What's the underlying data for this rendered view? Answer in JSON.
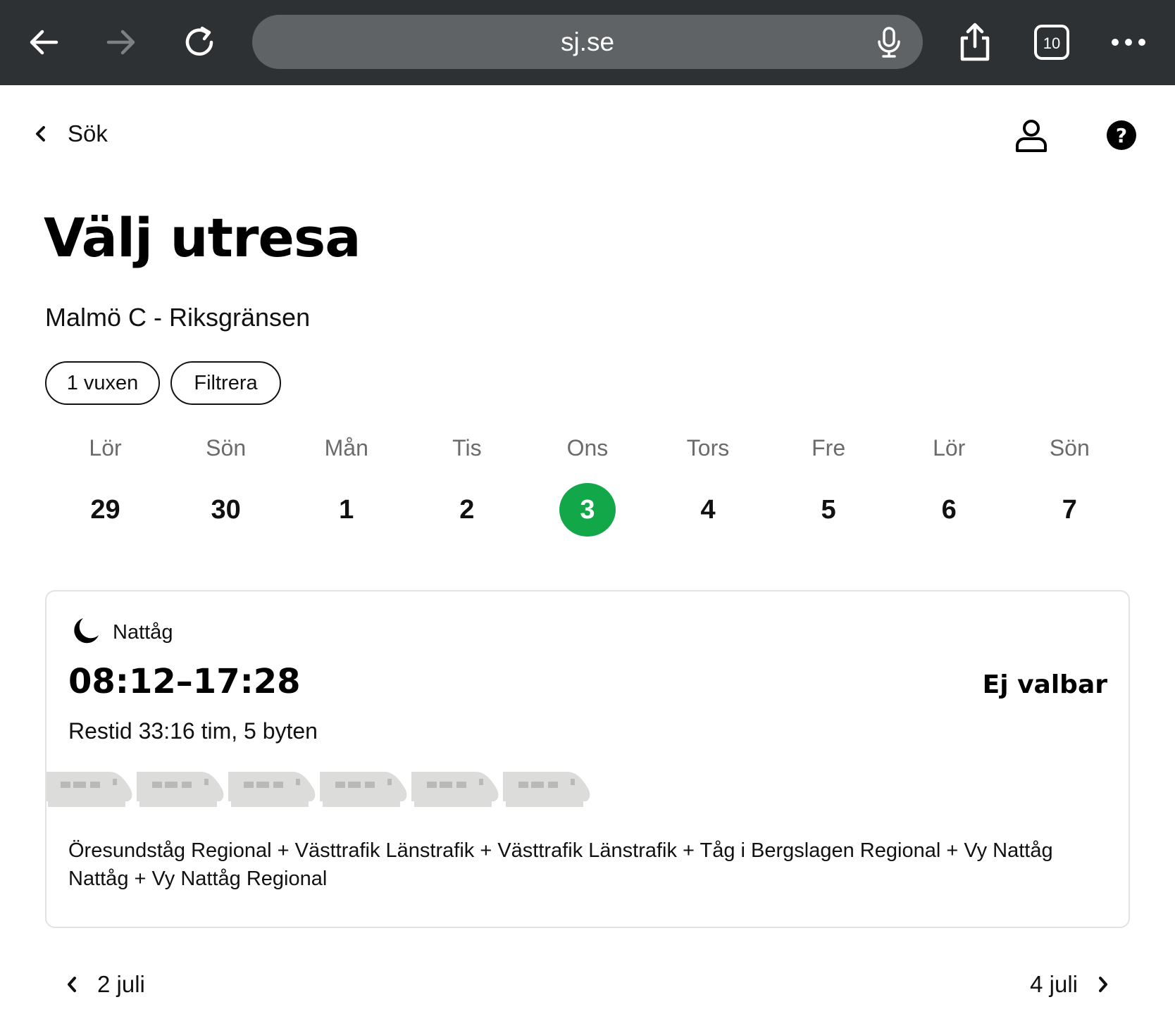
{
  "browser": {
    "url": "sj.se",
    "tab_count": "10"
  },
  "nav": {
    "back_label": "Sök"
  },
  "header": {
    "title": "Välj utresa",
    "route": "Malmö C - Riksgränsen"
  },
  "filters": {
    "passengers_label": "1 vuxen",
    "filter_label": "Filtrera"
  },
  "dates": [
    {
      "day": "Lör",
      "num": "29",
      "selected": false
    },
    {
      "day": "Sön",
      "num": "30",
      "selected": false
    },
    {
      "day": "Mån",
      "num": "1",
      "selected": false
    },
    {
      "day": "Tis",
      "num": "2",
      "selected": false
    },
    {
      "day": "Ons",
      "num": "3",
      "selected": true
    },
    {
      "day": "Tors",
      "num": "4",
      "selected": false
    },
    {
      "day": "Fre",
      "num": "5",
      "selected": false
    },
    {
      "day": "Lör",
      "num": "6",
      "selected": false
    },
    {
      "day": "Sön",
      "num": "7",
      "selected": false
    }
  ],
  "trip": {
    "train_type": "Nattåg",
    "time": "08:12–17:28",
    "status": "Ej valbar",
    "duration": "Restid 33:16 tim, 5 byten",
    "operators": "Öresundståg Regional + Västtrafik Länstrafik + Västtrafik Länstrafik + Tåg i Bergslagen Regional + Vy Nattåg Nattåg + Vy Nattåg Regional",
    "train_icon_count": 6
  },
  "pager": {
    "prev_label": "2 juli",
    "next_label": "4 juli"
  },
  "colors": {
    "browser_bar": "#2e3133",
    "url_field": "#5f6366",
    "selected_date": "#12a84a",
    "train_icon": "#dcdcda"
  }
}
